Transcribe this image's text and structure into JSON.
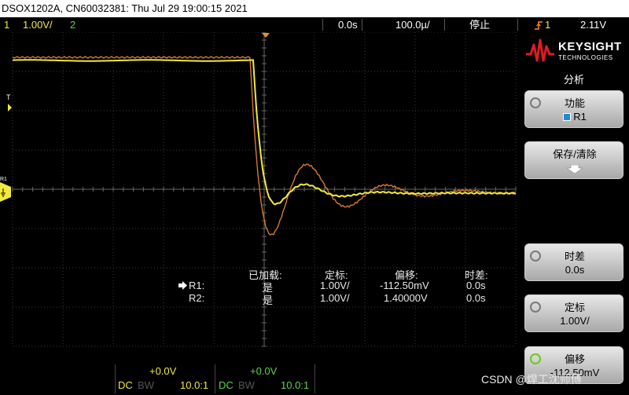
{
  "titlebar": {
    "text": "DSOX1202A, CN60032381: Thu Jul 29 19:00:15 2021"
  },
  "status": {
    "ch1_num": "1",
    "ch1_scale": "1.00V/",
    "ch2_num": "2",
    "timebase_delay": "0.0s",
    "timebase_scale": "100.0µ/",
    "run_state": "停止",
    "trigger_icon": "trigger-edge-icon",
    "trigger_source": "1",
    "trigger_level": "2.11V"
  },
  "screen": {
    "trigger_marker": "T",
    "ref_marker": "R1",
    "measurements": {
      "headers": [
        "已加载:",
        "定标:",
        "偏移:",
        "时差:"
      ],
      "rows": [
        {
          "name": "R1:",
          "loaded": "是",
          "scale": "1.00V/",
          "offset": "-112.50mV",
          "delay": "0.0s"
        },
        {
          "name": "R2:",
          "loaded": "是",
          "scale": "1.00V/",
          "offset": "1.40000V",
          "delay": "0.0s"
        }
      ]
    }
  },
  "channels": [
    {
      "offset": "+0.0V",
      "coupling": "DC",
      "bw": "BW",
      "probe": "10.0:1"
    },
    {
      "offset": "+0.0V",
      "coupling": "DC",
      "bw": "BW",
      "probe": "10.0:1"
    }
  ],
  "panel": {
    "brand": "KEYSIGHT",
    "brand_sub": "TECHNOLOGIES",
    "menu_title": "分析",
    "softkeys": [
      {
        "label": "功能",
        "value": "R1",
        "checked": true
      },
      {
        "label": "保存/清除",
        "value": ""
      },
      {
        "label": "时差",
        "value": "0.0s"
      },
      {
        "label": "定标",
        "value": "1.00V/"
      },
      {
        "label": "偏移",
        "value": "-112.50mV"
      }
    ]
  },
  "watermark": "CSDN @焊工沈师傅",
  "colors": {
    "ch1": "#f2e93c",
    "ref": "#d47a2a",
    "ch2": "#5ad64a",
    "trigger": "#ff8c1a",
    "grid": "#555555"
  }
}
